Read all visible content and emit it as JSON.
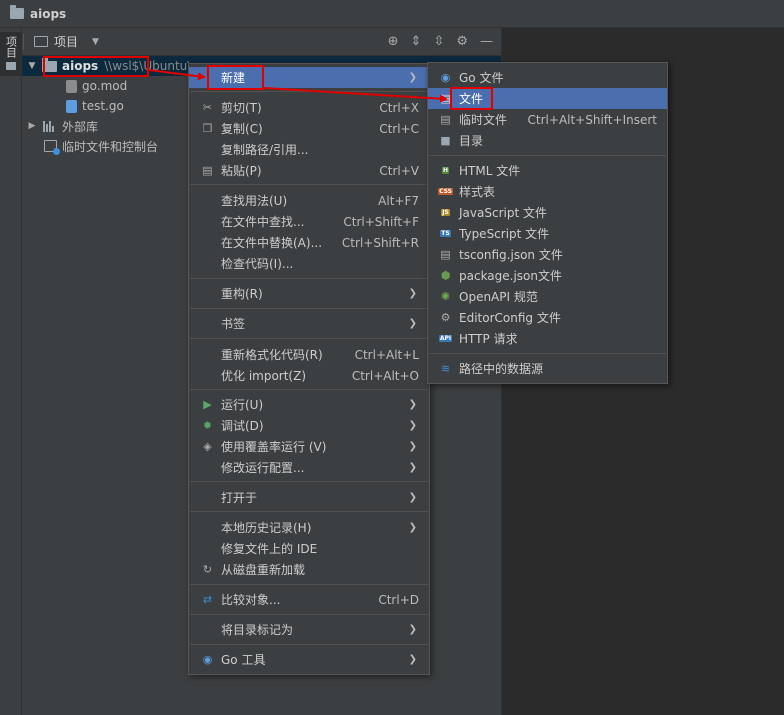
{
  "window": {
    "title": "aiops"
  },
  "left_strip": {
    "project_tab": "项目"
  },
  "panel": {
    "label": "项目"
  },
  "tree": [
    {
      "label": "aiops",
      "path": "\\\\wsl$\\Ubuntu\\"
    },
    {
      "label": "go.mod"
    },
    {
      "label": "test.go"
    },
    {
      "label": "外部库"
    },
    {
      "label": "临时文件和控制台"
    }
  ],
  "context_menu": {
    "items": [
      {
        "label": "新建",
        "shortcut": ""
      },
      {
        "label": "剪切(T)",
        "shortcut": "Ctrl+X"
      },
      {
        "label": "复制(C)",
        "shortcut": "Ctrl+C"
      },
      {
        "label": "复制路径/引用...",
        "shortcut": ""
      },
      {
        "label": "粘贴(P)",
        "shortcut": "Ctrl+V"
      },
      {
        "label": "查找用法(U)",
        "shortcut": "Alt+F7"
      },
      {
        "label": "在文件中查找...",
        "shortcut": "Ctrl+Shift+F"
      },
      {
        "label": "在文件中替换(A)...",
        "shortcut": "Ctrl+Shift+R"
      },
      {
        "label": "检查代码(I)...",
        "shortcut": ""
      },
      {
        "label": "重构(R)",
        "shortcut": ""
      },
      {
        "label": "书签",
        "shortcut": ""
      },
      {
        "label": "重新格式化代码(R)",
        "shortcut": "Ctrl+Alt+L"
      },
      {
        "label": "优化 import(Z)",
        "shortcut": "Ctrl+Alt+O"
      },
      {
        "label": "运行(U)",
        "shortcut": ""
      },
      {
        "label": "调试(D)",
        "shortcut": ""
      },
      {
        "label": "使用覆盖率运行 (V)",
        "shortcut": ""
      },
      {
        "label": "修改运行配置...",
        "shortcut": ""
      },
      {
        "label": "打开于",
        "shortcut": ""
      },
      {
        "label": "本地历史记录(H)",
        "shortcut": ""
      },
      {
        "label": "修复文件上的 IDE",
        "shortcut": ""
      },
      {
        "label": "从磁盘重新加载",
        "shortcut": ""
      },
      {
        "label": "比较对象...",
        "shortcut": "Ctrl+D"
      },
      {
        "label": "将目录标记为",
        "shortcut": ""
      },
      {
        "label": "Go 工具",
        "shortcut": ""
      }
    ]
  },
  "new_submenu": {
    "items": [
      {
        "label": "Go 文件",
        "shortcut": ""
      },
      {
        "label": "文件",
        "shortcut": ""
      },
      {
        "label": "临时文件",
        "shortcut": "Ctrl+Alt+Shift+Insert"
      },
      {
        "label": "目录",
        "shortcut": ""
      },
      {
        "label": "HTML 文件",
        "shortcut": ""
      },
      {
        "label": "样式表",
        "shortcut": ""
      },
      {
        "label": "JavaScript 文件",
        "shortcut": ""
      },
      {
        "label": "TypeScript 文件",
        "shortcut": ""
      },
      {
        "label": "tsconfig.json 文件",
        "shortcut": ""
      },
      {
        "label": "package.json文件",
        "shortcut": ""
      },
      {
        "label": "OpenAPI 规范",
        "shortcut": ""
      },
      {
        "label": "EditorConfig 文件",
        "shortcut": ""
      },
      {
        "label": "HTTP 请求",
        "shortcut": ""
      },
      {
        "label": "路径中的数据源",
        "shortcut": ""
      }
    ]
  },
  "colors": {
    "highlight": "#4b6eaf",
    "annotation_red": "#e00000",
    "background": "#2b2b2b",
    "panel": "#3c3f41"
  }
}
